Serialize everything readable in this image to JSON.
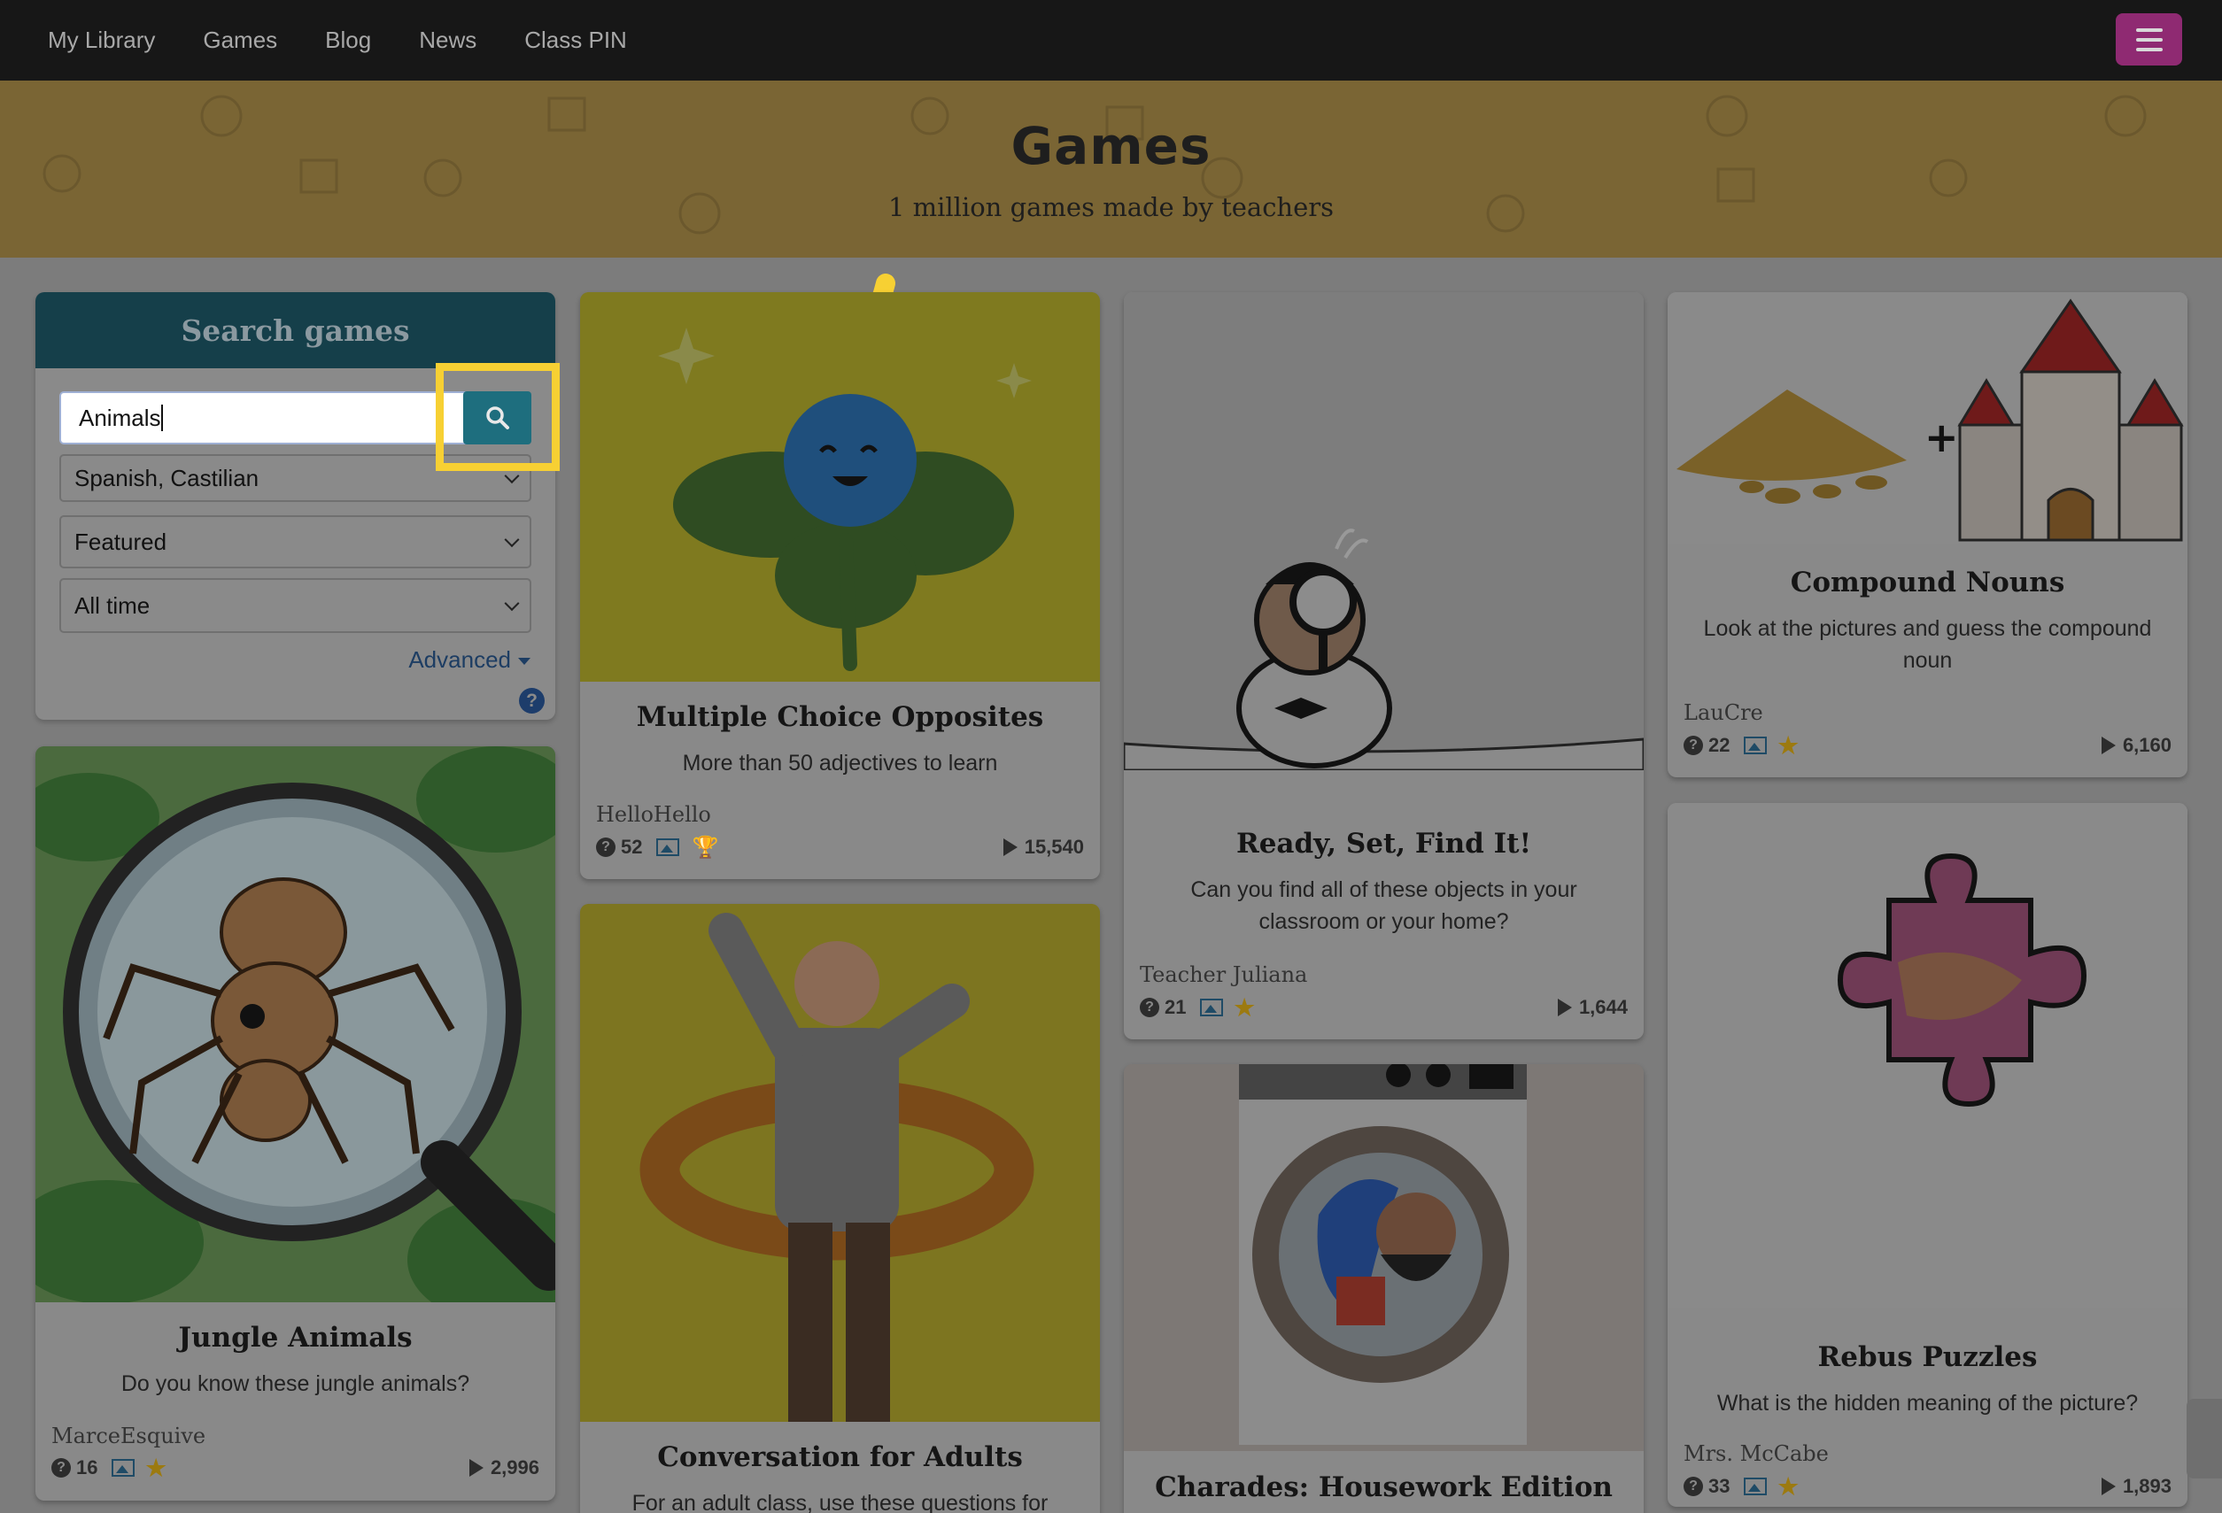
{
  "nav": {
    "items": [
      "My Library",
      "Games",
      "Blog",
      "News",
      "Class PIN"
    ]
  },
  "banner": {
    "title": "Games",
    "subtitle": "1 million games made by teachers"
  },
  "search": {
    "heading": "Search games",
    "query": "Animals",
    "language": "Spanish, Castilian",
    "sort": "Featured",
    "period": "All time",
    "advanced": "Advanced",
    "help": "?"
  },
  "cards": [
    {
      "title": "Jungle Animals",
      "desc": "Do you know these jungle animals?",
      "author": "MarceEsquive",
      "questions": "16",
      "plays": "2,996",
      "badge": "star"
    },
    {
      "title": "Multiple Choice Opposites",
      "desc": "More than 50 adjectives to learn",
      "author": "HelloHello",
      "questions": "52",
      "plays": "15,540",
      "badge": "trophy"
    },
    {
      "title": "Conversation for Adults",
      "desc": "For an adult class, use these questions for"
    },
    {
      "title": "Ready, Set, Find It!",
      "desc": "Can you find all of these objects in your classroom or your home?",
      "author": "Teacher Juliana",
      "questions": "21",
      "plays": "1,644",
      "badge": "star"
    },
    {
      "title": "Charades: Housework Edition"
    },
    {
      "title": "Compound Nouns",
      "desc": "Look at the pictures and guess the compound noun",
      "author": "LauCre",
      "questions": "22",
      "plays": "6,160",
      "badge": "star"
    },
    {
      "title": "Rebus Puzzles",
      "desc": "What is the hidden meaning of the picture?",
      "author": "Mrs. McCabe",
      "questions": "33",
      "plays": "1,893",
      "badge": "star"
    }
  ],
  "colors": {
    "highlight": "#f7d033",
    "nav_bg": "#171717",
    "banner_bg": "#7a6534",
    "search_head": "#153f4a",
    "search_button": "#1e6e7e",
    "menu_button": "#8f2a72"
  }
}
